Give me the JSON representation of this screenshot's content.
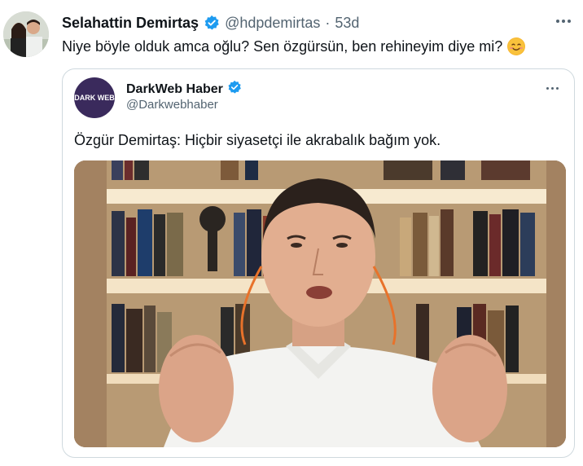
{
  "tweet": {
    "author_name": "Selahattin Demirtaş",
    "author_handle": "@hdpdemirtas",
    "separator": "·",
    "age": "53d",
    "text": "Niye böyle olduk amca oğlu? Sen özgürsün, ben rehineyim diye mi?",
    "emoji": "smiling-face-icon"
  },
  "quoted": {
    "author_name": "DarkWeb Haber",
    "author_handle": "@Darkwebhaber",
    "avatar_text": "DARK WEB",
    "text": "Özgür Demirtaş: Hiçbir siyasetçi ile akrabalık bağım yok."
  },
  "colors": {
    "verified": "#1d9bf0",
    "secondary_text": "#536471",
    "border": "#cfd9de"
  }
}
